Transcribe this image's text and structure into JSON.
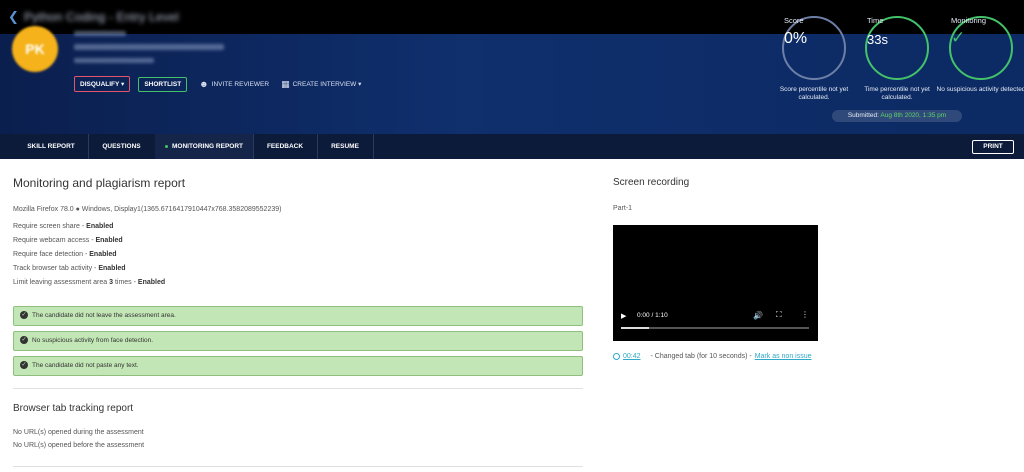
{
  "topbar": {
    "back_icon": "chevron-left-icon",
    "title": "Python Coding - Entry Level"
  },
  "candidate": {
    "initials": "PK"
  },
  "actions": {
    "disqualify": "DISQUALIFY ▾",
    "shortlist": "SHORTLIST",
    "invite_reviewer": "INVITE REVIEWER",
    "create_interview": "CREATE INTERVIEW ▾"
  },
  "metrics": {
    "score": {
      "label": "Score",
      "value": "0%",
      "caption": "Score percentile not yet calculated."
    },
    "time": {
      "label": "Time",
      "value": "33s",
      "caption": "Time percentile not yet calculated."
    },
    "monitoring": {
      "label": "Monitoring",
      "icon": "check-icon",
      "caption": "No suspicious activity detected"
    }
  },
  "submitted": {
    "prefix": "Submitted:",
    "date": "Aug 8th 2020, 1:35 pm"
  },
  "nav": {
    "tabs": [
      "SKILL REPORT",
      "QUESTIONS",
      "MONITORING REPORT",
      "FEEDBACK",
      "RESUME"
    ],
    "active": "MONITORING REPORT",
    "print": "PRINT"
  },
  "report": {
    "title": "Monitoring and plagiarism report",
    "browser": "Mozilla Firefox 78.0 ● Windows, Display1(1365.6716417910447x768.3582089552239)",
    "requirements": [
      {
        "label": "Require screen share - ",
        "value": "Enabled"
      },
      {
        "label": "Require webcam access - ",
        "value": "Enabled"
      },
      {
        "label": "Require face detection - ",
        "value": "Enabled"
      },
      {
        "label": "Track browser tab activity - ",
        "value": "Enabled"
      },
      {
        "label": "Limit leaving assessment area ",
        "count": "3",
        "suffix": " times - ",
        "value": "Enabled"
      }
    ],
    "alerts": [
      "The candidate did not leave the assessment area.",
      "No suspicious activity from face detection.",
      "The candidate did not paste any text."
    ]
  },
  "tab_tracking": {
    "title": "Browser tab tracking report",
    "during": "No URL(s) opened during the assessment",
    "before": "No URL(s) opened before the assessment"
  },
  "recording": {
    "title": "Screen recording",
    "part": "Part-1",
    "time": "0:00 / 1:10",
    "progress": 0.0,
    "event": {
      "timestamp": "00:42",
      "text": "- Changed tab (for 10 seconds) -",
      "action": "Mark as non issue"
    }
  }
}
